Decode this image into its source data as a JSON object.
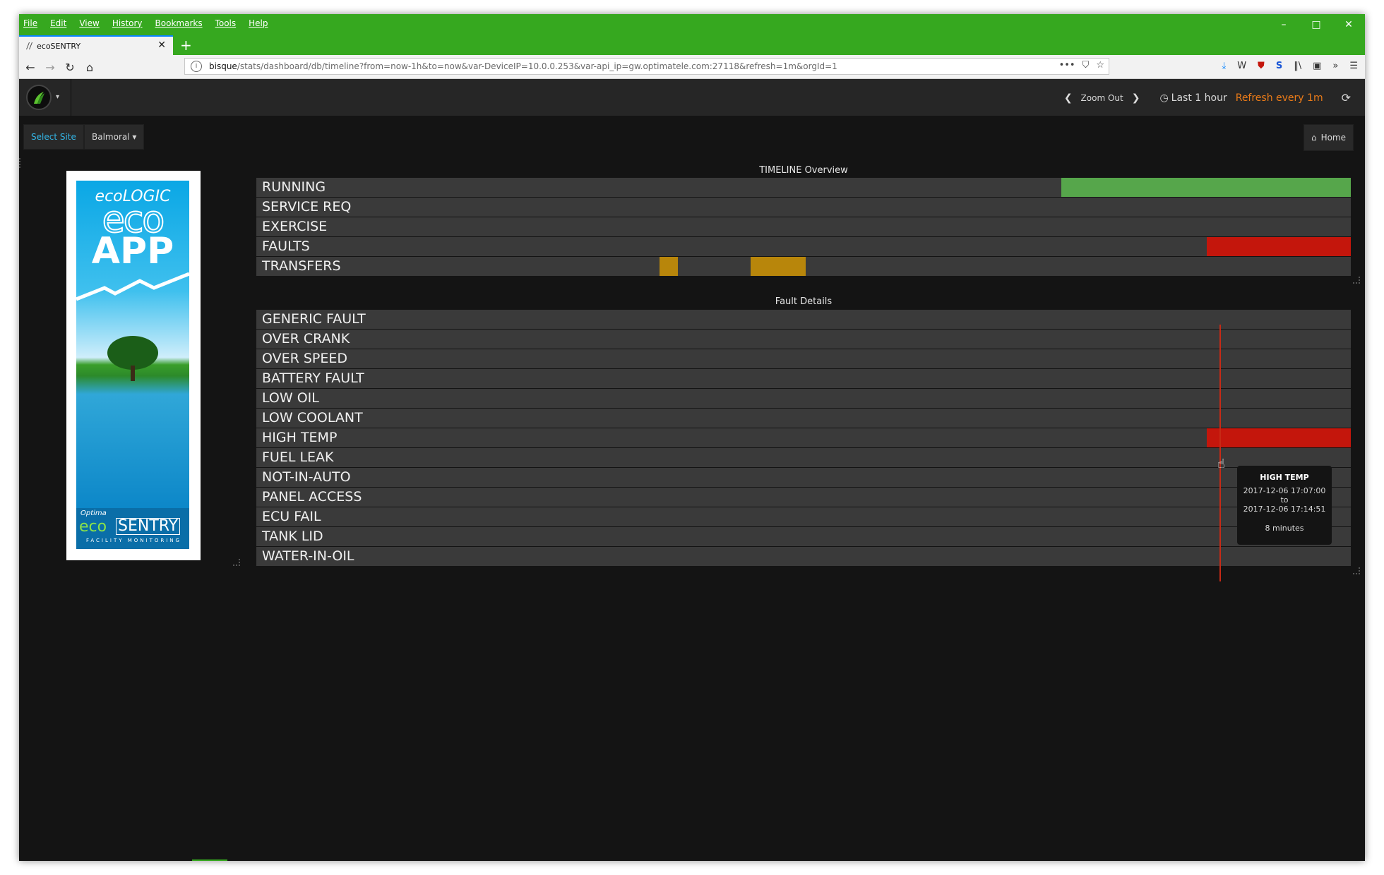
{
  "browser": {
    "menu": [
      "File",
      "Edit",
      "View",
      "History",
      "Bookmarks",
      "Tools",
      "Help"
    ],
    "window_controls": {
      "minimize": "–",
      "maximize": "□",
      "close": "✕"
    },
    "tab_title": "ecoSENTRY",
    "tab_close": "✕",
    "new_tab": "+",
    "url_host": "bisque",
    "url_path": "/stats/dashboard/db/timeline?from=now-1h&to=now&var-DeviceIP=10.0.0.253&var-api_ip=gw.optimatele.com:27118&refresh=1m&orgId=1",
    "url_actions": [
      "•••",
      "⛉",
      "☆"
    ],
    "toolbar_icons": [
      "⤓",
      "W",
      "⛊",
      "S",
      "‖\\",
      "▣",
      "»",
      "☰"
    ],
    "chrome_color": "#36a81f"
  },
  "dashboard_nav": {
    "zoom_out": "Zoom Out",
    "time_range": "Last 1 hour",
    "refresh": "Refresh every 1m",
    "refresh_color": "#eb7b18"
  },
  "submenu": {
    "select_site": "Select Site",
    "site_value": "Balmoral ▾",
    "home": "Home"
  },
  "ad": {
    "line1": "ecoLOGIC",
    "line2": "eco",
    "line3": "APP",
    "brand_small": "Optima",
    "brand_eco": "eco",
    "brand_sentry": "SENTRY",
    "tagline": "FACILITY MONITORING"
  },
  "timeline_overview": {
    "title": "TIMELINE Overview",
    "rows": [
      "RUNNING",
      "SERVICE REQ",
      "EXERCISE",
      "FAULTS",
      "TRANSFERS"
    ],
    "colors": {
      "running": "#56a64b",
      "fault": "#c4160c",
      "transfer": "#b8860b"
    }
  },
  "fault_details": {
    "title": "Fault Details",
    "rows": [
      "GENERIC FAULT",
      "OVER CRANK",
      "OVER SPEED",
      "BATTERY FAULT",
      "LOW OIL",
      "LOW COOLANT",
      "HIGH TEMP",
      "FUEL LEAK",
      "NOT-IN-AUTO",
      "PANEL ACCESS",
      "ECU FAIL",
      "TANK LID",
      "WATER-IN-OIL"
    ]
  },
  "tooltip": {
    "title": "HIGH TEMP",
    "start": "2017-12-06 17:07:00",
    "to": "to",
    "end": "2017-12-06 17:14:51",
    "duration": "8 minutes"
  }
}
